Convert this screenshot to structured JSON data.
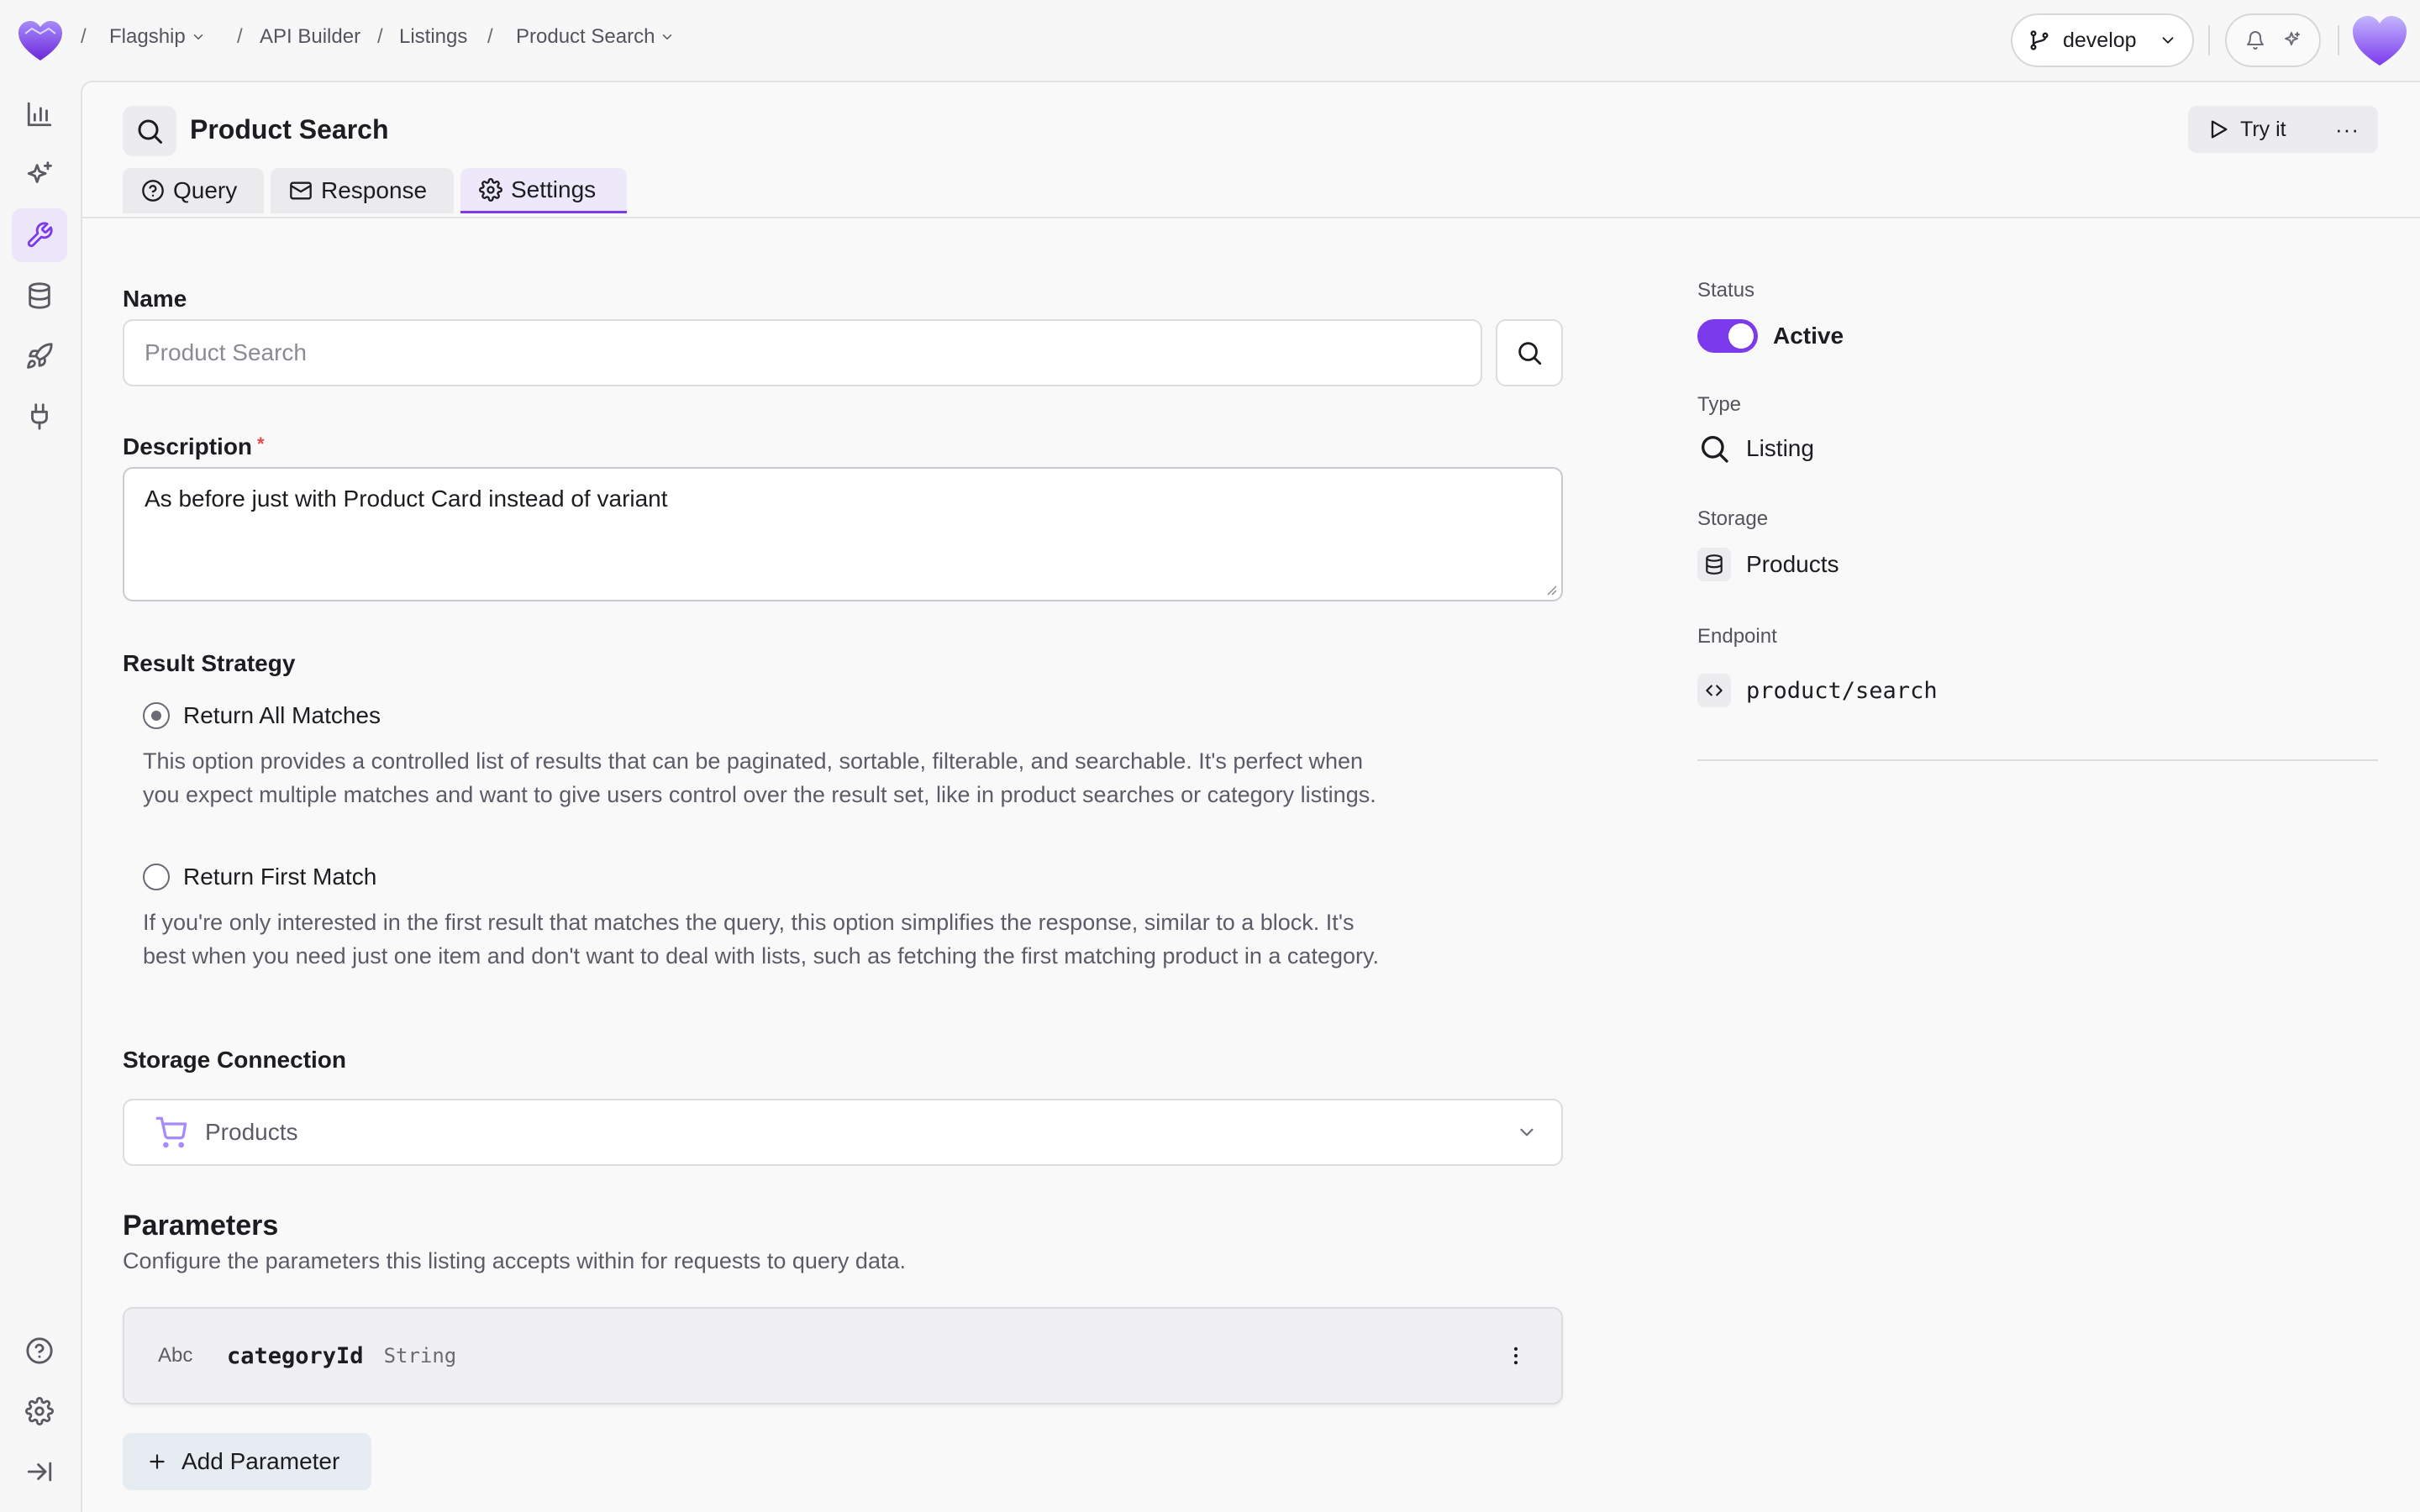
{
  "breadcrumbs": {
    "project": "Flagship",
    "section": "API Builder",
    "group": "Listings",
    "item": "Product Search"
  },
  "branch": {
    "label": "develop"
  },
  "colors": {
    "accent": "#7c3aed",
    "required": "#e5484d"
  },
  "sidebar": {
    "items": [
      {
        "icon": "bar-chart-icon",
        "active": false
      },
      {
        "icon": "sparkles-icon",
        "active": false
      },
      {
        "icon": "wrench-icon",
        "active": true
      },
      {
        "icon": "database-icon",
        "active": false
      },
      {
        "icon": "rocket-icon",
        "active": false
      },
      {
        "icon": "plug-icon",
        "active": false
      }
    ],
    "bottom": [
      "help-icon",
      "gear-icon",
      "collapse-icon"
    ]
  },
  "header": {
    "title": "Product Search",
    "try_label": "Try it",
    "more_label": "···",
    "tabs": [
      {
        "label": "Query",
        "icon": "question-circle-icon"
      },
      {
        "label": "Response",
        "icon": "envelope-icon"
      },
      {
        "label": "Settings",
        "icon": "gear-icon",
        "active": true
      }
    ]
  },
  "form": {
    "name_label": "Name",
    "name_placeholder": "Product Search",
    "description_label": "Description",
    "required_mark": "*",
    "description_value": "As before just with Product Card instead of variant",
    "strategy_label": "Result Strategy",
    "options": [
      {
        "label": "Return All Matches",
        "selected": true,
        "description": "This option provides a controlled list of results that can be paginated, sortable, filterable, and searchable. It's perfect when you expect multiple matches and want to give users control over the result set, like in product searches or category listings."
      },
      {
        "label": "Return First Match",
        "selected": false,
        "description": "If you're only interested in the first result that matches the query, this option simplifies the response, similar to a block. It's best when you need just one item and don't want to deal with lists, such as fetching the first matching product in a category."
      }
    ],
    "storage_label": "Storage Connection",
    "storage_value": "Products"
  },
  "parameters": {
    "title": "Parameters",
    "subtitle": "Configure the parameters this listing accepts within for requests to query data.",
    "items": [
      {
        "type_badge": "Abc",
        "name": "categoryId",
        "type": "String"
      }
    ],
    "add_label": "Add Parameter"
  },
  "details": {
    "status_label": "Status",
    "status_value": "Active",
    "status_on": true,
    "type_label": "Type",
    "type_value": "Listing",
    "storage_label": "Storage",
    "storage_value": "Products",
    "endpoint_label": "Endpoint",
    "endpoint_value": "product/search"
  }
}
